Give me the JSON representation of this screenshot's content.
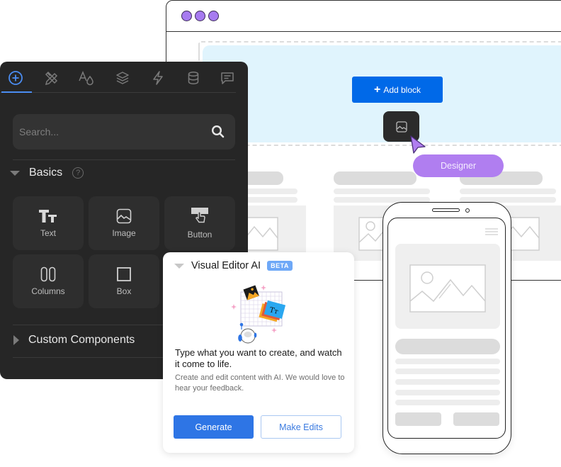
{
  "browser": {
    "window_dots": [
      "close",
      "minimize",
      "maximize"
    ],
    "add_block_label": "Add block",
    "add_block_icon": "plus-icon",
    "drag_chip_icon": "image-icon",
    "cursor_icon": "pointer-cursor-icon",
    "collaborator_label": "Designer"
  },
  "panel": {
    "tabs": [
      {
        "name": "add",
        "icon": "plus-circle-icon",
        "active": true
      },
      {
        "name": "design",
        "icon": "pencil-ruler-icon",
        "active": false
      },
      {
        "name": "typography",
        "icon": "text-color-icon",
        "active": false
      },
      {
        "name": "layers",
        "icon": "layers-icon",
        "active": false
      },
      {
        "name": "actions",
        "icon": "lightning-icon",
        "active": false
      },
      {
        "name": "data",
        "icon": "database-icon",
        "active": false
      },
      {
        "name": "comments",
        "icon": "comment-icon",
        "active": false
      }
    ],
    "search": {
      "value": "",
      "placeholder": "Search..."
    },
    "basics_label": "Basics",
    "help_glyph": "?",
    "tiles": [
      {
        "label": "Text",
        "icon": "text-icon"
      },
      {
        "label": "Image",
        "icon": "image-icon"
      },
      {
        "label": "Button",
        "icon": "button-icon"
      },
      {
        "label": "Columns",
        "icon": "columns-icon"
      },
      {
        "label": "Box",
        "icon": "box-icon"
      }
    ],
    "custom_components_label": "Custom Components"
  },
  "ai_card": {
    "title": "Visual Editor AI",
    "badge": "BETA",
    "heading": "Type what you want to create, and watch it come to life.",
    "subtext": "Create and edit content with AI. We would love to hear your feedback.",
    "generate_label": "Generate",
    "make_edits_label": "Make Edits"
  },
  "colors": {
    "accent_blue": "#0069e8",
    "generate_blue": "#2e75e5",
    "designer_purple": "#b07ef0",
    "panel_dark": "#262626",
    "hero_light_blue": "#e0f4fd",
    "beta_badge": "#6ea8f7"
  }
}
